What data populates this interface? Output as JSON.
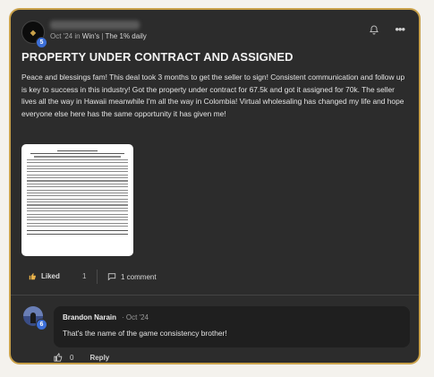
{
  "post": {
    "meta_date": "Oct '24",
    "meta_in": "in",
    "meta_group": "Win's",
    "meta_sep": "|",
    "meta_category": "The 1% daily",
    "level": "5",
    "title": "PROPERTY UNDER CONTRACT AND ASSIGNED",
    "body": "Peace and blessings fam! This deal took 3 months to get the seller to sign! Consistent communication and follow up is key to success in this industry! Got the property under contract for 67.5k and got it assigned for 70k. The seller lives all the way in Hawaii meanwhile I'm all the way in Colombia! Virtual wholesaling has changed my life and hope everyone else here has the same opportunity it has given me!"
  },
  "actions": {
    "like_label": "Liked",
    "like_count": "1",
    "comment_label": "1 comment"
  },
  "comment": {
    "author": "Brandon Narain",
    "date": "· Oct '24",
    "level": "6",
    "text": "That's the name of the game consistency brother!",
    "like_count": "0",
    "reply_label": "Reply"
  },
  "icons": {
    "bell": "bell-icon",
    "more": "more-options-icon",
    "like": "thumbs-up-icon",
    "comment": "comment-icon"
  },
  "colors": {
    "card_border": "#c9a14a",
    "card_bg": "#2c2c2c",
    "like_icon": "#e8b14a",
    "level_badge": "#3c6fd8"
  }
}
